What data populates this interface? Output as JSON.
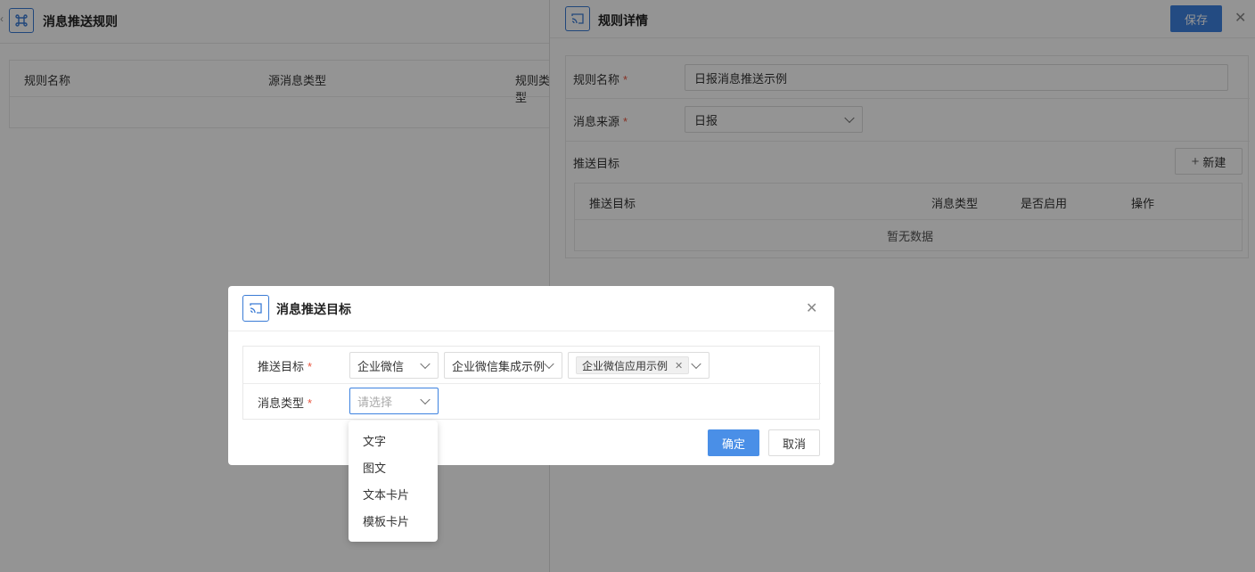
{
  "left_page": {
    "collapse_glyph": "‹",
    "title": "消息推送规则",
    "table_headers": [
      "规则名称",
      "源消息类型",
      "规则类型"
    ]
  },
  "drawer": {
    "title": "规则详情",
    "save_label": "保存",
    "fields": {
      "rule_name_label": "规则名称",
      "rule_name_value": "日报消息推送示例",
      "source_label": "消息来源",
      "source_value": "日报",
      "targets_label": "推送目标",
      "new_label": "新建"
    },
    "targets_table": {
      "headers": [
        "推送目标",
        "消息类型",
        "是否启用",
        "操作"
      ],
      "empty_text": "暂无数据"
    }
  },
  "modal": {
    "title": "消息推送目标",
    "target_label": "推送目标",
    "target_platform": "企业微信",
    "target_integration": "企业微信集成示例",
    "target_app_tag": "企业微信应用示例",
    "msg_type_label": "消息类型",
    "msg_type_placeholder": "请选择",
    "ok_label": "确定",
    "cancel_label": "取消",
    "options": [
      "文字",
      "图文",
      "文本卡片",
      "模板卡片"
    ]
  },
  "colors": {
    "primary": "#3d82e0",
    "required": "#e8553f",
    "overlay": "rgba(0,0,0,0.42)"
  }
}
